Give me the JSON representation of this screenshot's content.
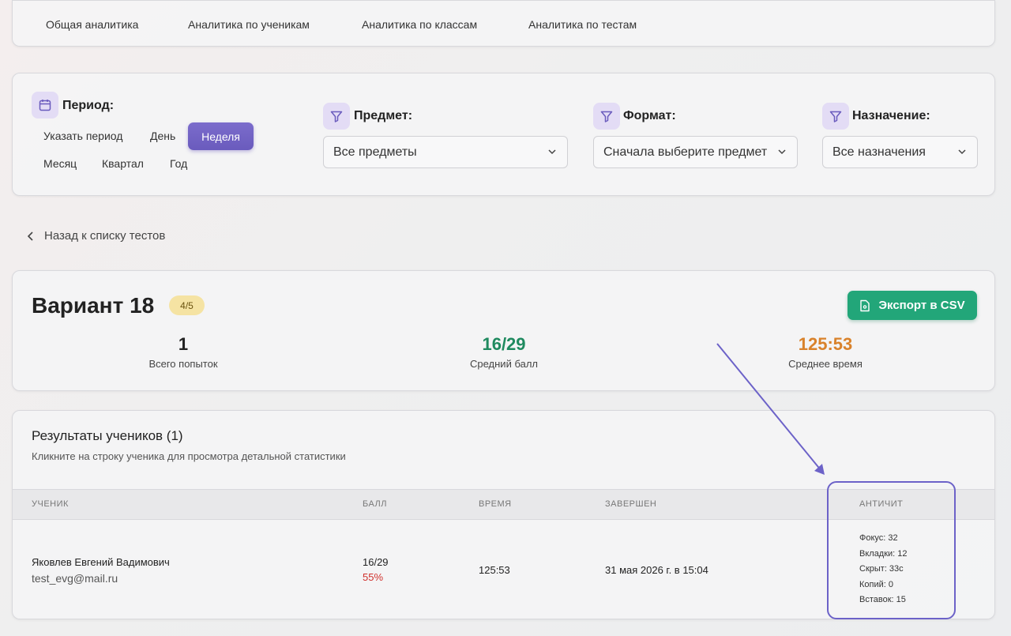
{
  "tabs": [
    "Общая аналитика",
    "Аналитика по ученикам",
    "Аналитика по классам",
    "Аналитика по тестам"
  ],
  "filters": {
    "period_label": "Период:",
    "period_options": {
      "custom": "Указать период",
      "day": "День",
      "week": "Неделя",
      "month": "Месяц",
      "quarter": "Квартал",
      "year": "Год"
    },
    "period_selected": "Неделя",
    "subject_label": "Предмет:",
    "subject_value": "Все предметы",
    "format_label": "Формат:",
    "format_value": "Сначала выберите предмет",
    "assignment_label": "Назначение:",
    "assignment_value": "Все назначения"
  },
  "back_link": "Назад к списку тестов",
  "summary": {
    "title": "Вариант 18",
    "badge": "4/5",
    "export_label": "Экспорт в CSV",
    "stats": [
      {
        "value": "1",
        "label": "Всего попыток",
        "color": "#222222"
      },
      {
        "value": "16/29",
        "label": "Средний балл",
        "color": "#1f8a5f"
      },
      {
        "value": "125:53",
        "label": "Среднее время",
        "color": "#d9822b"
      }
    ]
  },
  "results": {
    "title": "Результаты учеников (1)",
    "subtitle": "Кликните на строку ученика для просмотра детальной статистики",
    "columns": {
      "student": "УЧЕНИК",
      "score": "БАЛЛ",
      "time": "ВРЕМЯ",
      "finished": "ЗАВЕРШЕН",
      "anticheat": "АНТИЧИТ"
    },
    "rows": [
      {
        "name": "Яковлев Евгений Вадимович",
        "email": "test_evg@mail.ru",
        "score": "16/29",
        "percent": "55%",
        "time": "125:53",
        "finished": "31 мая 2026 г. в 15:04",
        "anticheat": [
          "Фокус: 32",
          "Вкладки: 12",
          "Скрыт: 33с",
          "Копий: 0",
          "Вставок: 15"
        ]
      }
    ]
  },
  "colors": {
    "accent": "#6a5bbd",
    "export": "#22a679",
    "percent_bad": "#d0312d",
    "annotation": "#6c62c8"
  }
}
